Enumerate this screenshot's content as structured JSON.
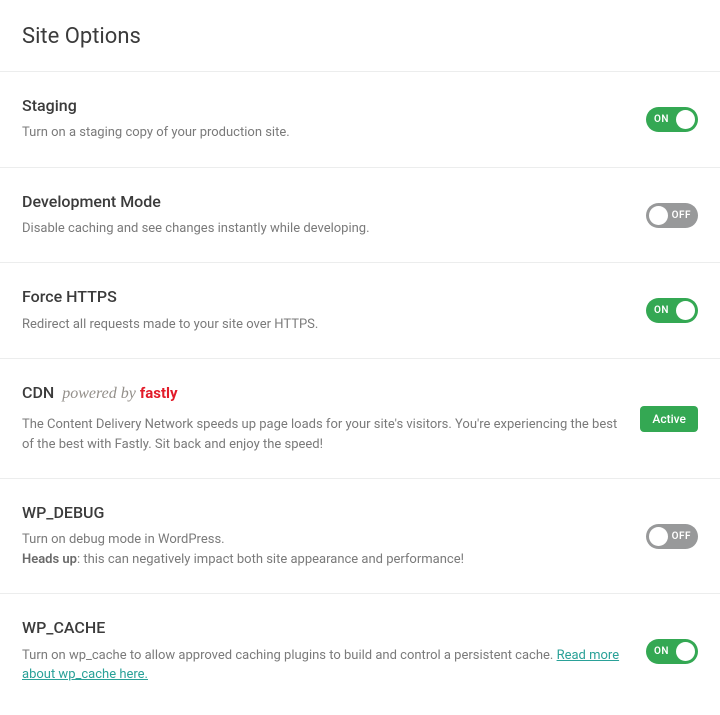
{
  "page_title": "Site Options",
  "toggle_labels": {
    "on": "ON",
    "off": "OFF"
  },
  "options": {
    "staging": {
      "title": "Staging",
      "desc": "Turn on a staging copy of your production site.",
      "state": "on"
    },
    "dev_mode": {
      "title": "Development Mode",
      "desc": "Disable caching and see changes instantly while developing.",
      "state": "off"
    },
    "force_https": {
      "title": "Force HTTPS",
      "desc": "Redirect all requests made to your site over HTTPS.",
      "state": "on"
    },
    "cdn": {
      "title_plain": "CDN",
      "powered_by_prefix": "powered by ",
      "powered_by_brand": "fastly",
      "desc": "The Content Delivery Network speeds up page loads for your site's visitors. You're experiencing the best of the best with Fastly. Sit back and enjoy the speed!",
      "badge": "Active"
    },
    "wp_debug": {
      "title": "WP_DEBUG",
      "desc_line1": "Turn on debug mode in WordPress.",
      "heads_up_label": "Heads up",
      "desc_line2": ": this can negatively impact both site appearance and performance!",
      "state": "off"
    },
    "wp_cache": {
      "title": "WP_CACHE",
      "desc_prefix": "Turn on wp_cache to allow approved caching plugins to build and control a persistent cache. ",
      "link_text": "Read more about wp_cache here.",
      "state": "on"
    }
  }
}
